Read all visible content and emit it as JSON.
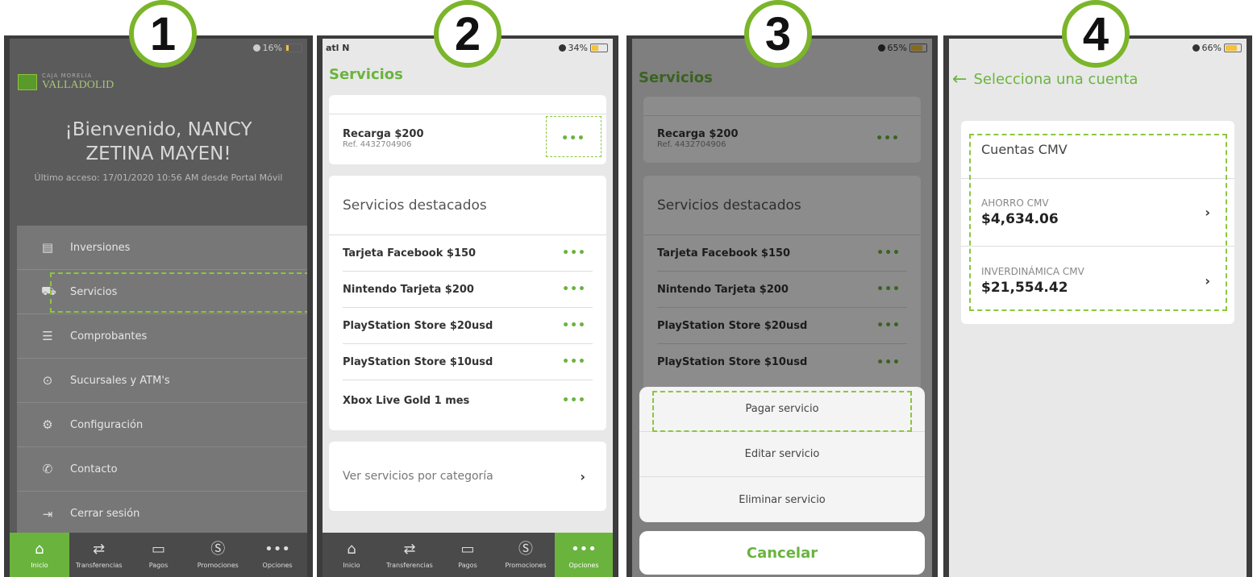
{
  "steps": [
    "1",
    "2",
    "3",
    "4"
  ],
  "colors": {
    "accent": "#6ab43e",
    "highlight": "#8cc63f"
  },
  "panel1": {
    "battery": "16%",
    "logo_small": "CAJA MORELIA",
    "logo_big": "VALLADOLID",
    "welcome_line1": "¡Bienvenido, NANCY",
    "welcome_line2": "ZETINA MAYEN!",
    "last_access": "Último acceso: 17/01/2020 10:56 AM desde Portal Móvil",
    "menu": [
      {
        "label": "Inversiones",
        "icon": "document-icon"
      },
      {
        "label": "Servicios",
        "icon": "services-icon"
      },
      {
        "label": "Comprobantes",
        "icon": "receipt-icon"
      },
      {
        "label": "Sucursales y ATM's",
        "icon": "location-pin-icon"
      },
      {
        "label": "Configuración",
        "icon": "gear-icon"
      },
      {
        "label": "Contacto",
        "icon": "phone-icon"
      },
      {
        "label": "Cerrar sesión",
        "icon": "logout-icon"
      }
    ]
  },
  "tabs": [
    {
      "label": "Inicio",
      "icon": "home-icon"
    },
    {
      "label": "Transferencias",
      "icon": "transfer-icon"
    },
    {
      "label": "Pagos",
      "icon": "payments-icon"
    },
    {
      "label": "Promociones",
      "icon": "dollar-coin-icon"
    },
    {
      "label": "Opciones",
      "icon": "more-icon"
    }
  ],
  "panel2": {
    "signal": "atl N",
    "battery": "34%",
    "title": "Servicios",
    "saved_service": {
      "name": "Recarga $200",
      "ref": "Ref. 4432704906"
    },
    "featured_title": "Servicios destacados",
    "featured": [
      "Tarjeta Facebook $150",
      "Nintendo Tarjeta $200",
      "PlayStation Store $20usd",
      "PlayStation Store $10usd",
      "Xbox Live Gold 1 mes"
    ],
    "by_category": "Ver servicios por categoría"
  },
  "panel3": {
    "battery": "65%",
    "title": "Servicios",
    "saved_service": {
      "name": "Recarga $200",
      "ref": "Ref. 4432704906"
    },
    "featured_title": "Servicios destacados",
    "featured": [
      "Tarjeta Facebook $150",
      "Nintendo Tarjeta $200",
      "PlayStation Store $20usd",
      "PlayStation Store $10usd"
    ],
    "sheet_options": [
      "Pagar servicio",
      "Editar servicio",
      "Eliminar servicio"
    ],
    "cancel": "Cancelar"
  },
  "panel4": {
    "battery": "66%",
    "title": "Selecciona una cuenta",
    "group": "Cuentas CMV",
    "accounts": [
      {
        "name": "AHORRO CMV",
        "balance": "$4,634.06"
      },
      {
        "name": "INVERDINÁMICA CMV",
        "balance": "$21,554.42"
      }
    ]
  }
}
